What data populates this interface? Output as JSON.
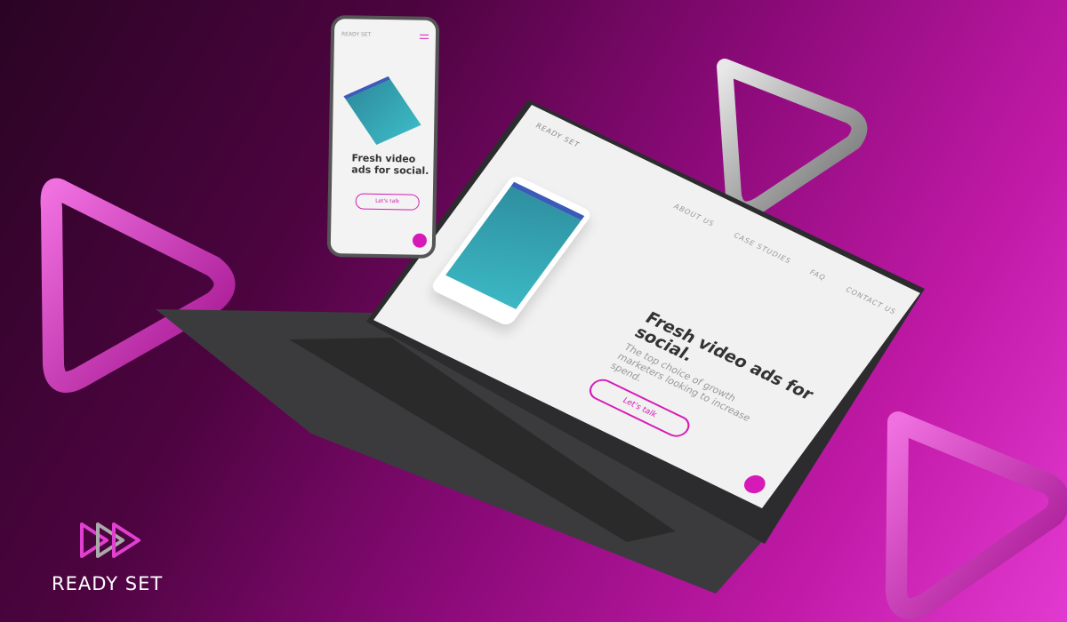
{
  "brand": {
    "name": "READY SET",
    "accent": "#d61ab8"
  },
  "website": {
    "logo_text": "READY SET",
    "nav": [
      "ABOUT US",
      "CASE STUDIES",
      "FAQ",
      "CONTACT US"
    ],
    "headline": "Fresh video ads for social.",
    "subheadline": "The top choice of growth marketers looking to increase spend.",
    "cta": "Let's talk"
  },
  "icons": [
    "play-triangle-icon",
    "chat-icon",
    "hamburger-menu-icon",
    "scroll-down-icon"
  ]
}
